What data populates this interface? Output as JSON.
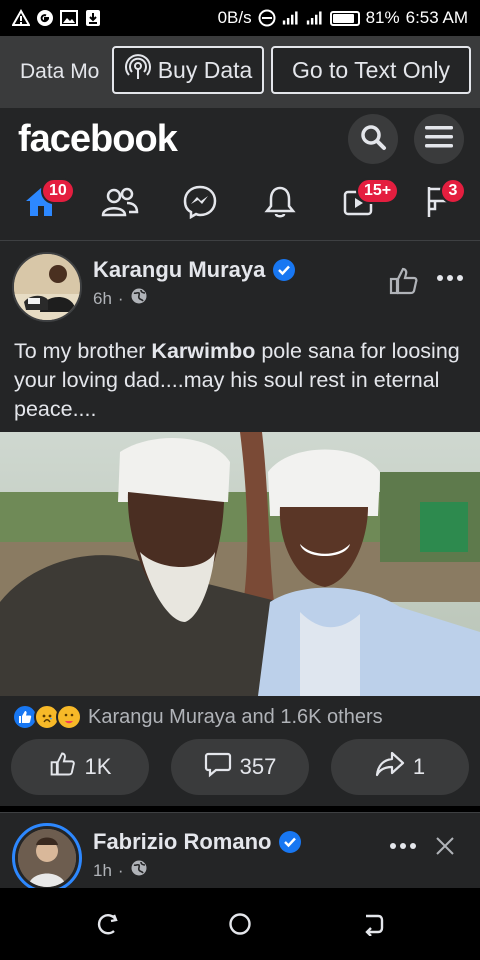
{
  "status_bar": {
    "net_speed": "0B/s",
    "battery_percent_label": "81%",
    "battery_level": 0.81,
    "time": "6:53 AM"
  },
  "data_bar": {
    "label": "Data Mo",
    "buy_data": "Buy Data",
    "text_only": "Go to Text Only"
  },
  "header": {
    "logo": "facebook",
    "tabs": [
      {
        "name": "home",
        "badge": "10"
      },
      {
        "name": "friends",
        "badge": ""
      },
      {
        "name": "messenger",
        "badge": ""
      },
      {
        "name": "notifications",
        "badge": ""
      },
      {
        "name": "watch",
        "badge": "15+"
      },
      {
        "name": "marketplace",
        "badge": "3"
      }
    ]
  },
  "posts": [
    {
      "author": "Karangu Muraya",
      "time": "6h",
      "text_before": "To my brother ",
      "text_bold": "Karwimbo",
      "text_after": " pole sana for loosing your loving dad....may his soul rest in eternal peace....",
      "reactions_text": "Karangu Muraya and 1.6K others",
      "likes": "1K",
      "comments": "357",
      "shares": "1"
    },
    {
      "author": "Fabrizio Romano",
      "time": "1h"
    }
  ],
  "colors": {
    "accent": "#2d88ff",
    "badge": "#e41e3f",
    "surface": "#242526",
    "button": "#3a3b3c"
  }
}
